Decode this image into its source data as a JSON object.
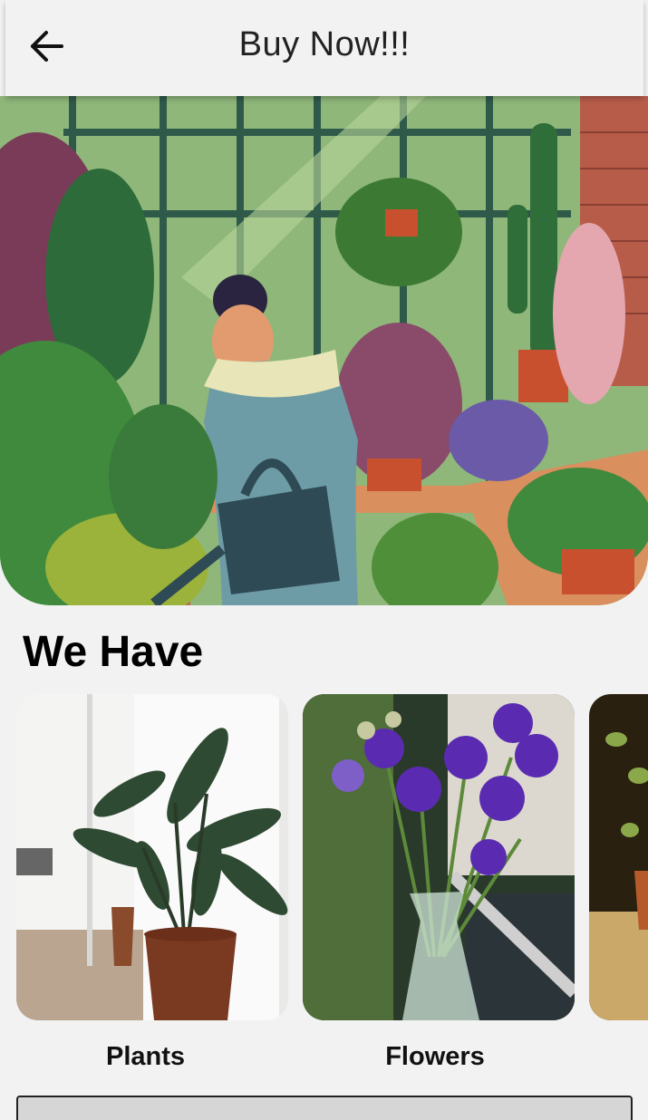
{
  "app_bar": {
    "title": "Buy Now!!!",
    "back_icon": "arrow-left-icon"
  },
  "hero": {
    "image": "illustration-woman-watering-plants-greenhouse"
  },
  "section": {
    "title": "We Have"
  },
  "categories": [
    {
      "label": "Plants",
      "image": "potted-banana-plant-photo"
    },
    {
      "label": "Flowers",
      "image": "purple-flowers-in-glass-vase-photo"
    },
    {
      "label": "",
      "image": "succulent-pot-partial-photo"
    }
  ],
  "colors": {
    "background": "#f2f2f2",
    "app_bar": "#f2f2f2",
    "text": "#000000"
  }
}
